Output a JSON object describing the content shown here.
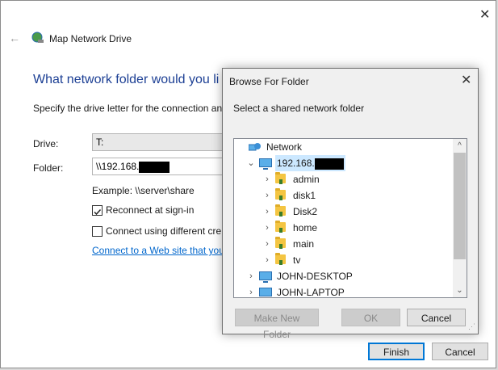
{
  "wizard": {
    "title": "Map Network Drive",
    "heading": "What network folder would you li",
    "instruction": "Specify the drive letter for the connection an",
    "drive_label": "Drive:",
    "drive_value": "T:",
    "folder_label": "Folder:",
    "folder_value": "\\\\192.168.",
    "example": "Example: \\\\server\\share",
    "reconnect_label": "Reconnect at sign-in",
    "reconnect_checked": true,
    "different_creds_label": "Connect using different cre",
    "different_creds_checked": false,
    "web_link": "Connect to a Web site that you",
    "finish_label": "Finish",
    "cancel_label": "Cancel"
  },
  "dialog": {
    "title": "Browse For Folder",
    "prompt": "Select a shared network folder",
    "tree": [
      {
        "label": "Network",
        "icon": "network-icon",
        "level": 0,
        "chevron": "",
        "selected": false
      },
      {
        "label": "192.168.",
        "icon": "computer-icon",
        "level": 1,
        "chevron": "expanded",
        "selected": true,
        "redacted": true
      },
      {
        "label": "admin",
        "icon": "shared-folder-icon",
        "level": 2,
        "chevron": "collapsed",
        "selected": false
      },
      {
        "label": "disk1",
        "icon": "shared-folder-icon",
        "level": 2,
        "chevron": "collapsed",
        "selected": false
      },
      {
        "label": "Disk2",
        "icon": "shared-folder-icon",
        "level": 2,
        "chevron": "collapsed",
        "selected": false
      },
      {
        "label": "home",
        "icon": "shared-folder-icon",
        "level": 2,
        "chevron": "collapsed",
        "selected": false
      },
      {
        "label": "main",
        "icon": "shared-folder-icon",
        "level": 2,
        "chevron": "collapsed",
        "selected": false
      },
      {
        "label": "tv",
        "icon": "shared-folder-icon",
        "level": 2,
        "chevron": "collapsed",
        "selected": false
      },
      {
        "label": "JOHN-DESKTOP",
        "icon": "computer-icon",
        "level": 1,
        "chevron": "collapsed",
        "selected": false
      },
      {
        "label": "JOHN-LAPTOP",
        "icon": "computer-icon",
        "level": 1,
        "chevron": "collapsed",
        "selected": false
      }
    ],
    "make_new_folder_label": "Make New Folder",
    "ok_label": "OK",
    "cancel_label": "Cancel"
  },
  "colors": {
    "heading": "#1c3f94",
    "link": "#0066cc",
    "selection": "#cce8ff",
    "primary_border": "#0078d7"
  }
}
